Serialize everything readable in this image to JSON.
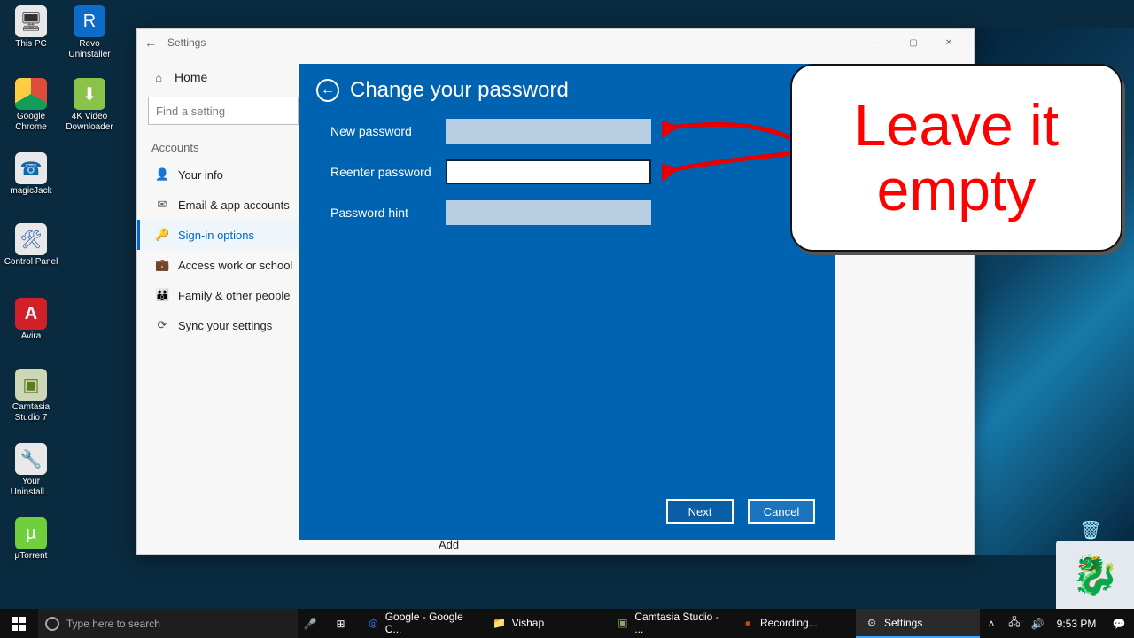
{
  "desktop": {
    "icons": [
      {
        "label": "This PC"
      },
      {
        "label": "Revo Uninstaller"
      },
      {
        "label": "Google Chrome"
      },
      {
        "label": "4K Video Downloader"
      },
      {
        "label": "magicJack"
      },
      {
        "label": "Control Panel"
      },
      {
        "label": "Avira"
      },
      {
        "label": "Camtasia Studio 7"
      },
      {
        "label": "Your Uninstall..."
      },
      {
        "label": "µTorrent"
      }
    ],
    "recycle": "Recycle Bin"
  },
  "settings": {
    "window_title": "Settings",
    "home": "Home",
    "search_placeholder": "Find a setting",
    "section": "Accounts",
    "nav": [
      {
        "icon": "👤",
        "label": "Your info"
      },
      {
        "icon": "✉",
        "label": "Email & app accounts"
      },
      {
        "icon": "🔑",
        "label": "Sign-in options"
      },
      {
        "icon": "💼",
        "label": "Access work or school"
      },
      {
        "icon": "👪",
        "label": "Family & other people"
      },
      {
        "icon": "⟳",
        "label": "Sync your settings"
      }
    ],
    "selected_nav": 2,
    "remnant": "Add"
  },
  "modal": {
    "title": "Change your password",
    "fields": {
      "new_password": "New password",
      "reenter_password": "Reenter password",
      "password_hint": "Password hint"
    },
    "values": {
      "new_password": "",
      "reenter_password": "",
      "password_hint": ""
    },
    "focused_field": "reenter_password",
    "buttons": {
      "next": "Next",
      "cancel": "Cancel"
    }
  },
  "callout": {
    "text": "Leave it empty"
  },
  "taskbar": {
    "search_placeholder": "Type here to search",
    "tasks": [
      {
        "icon": "◎",
        "label": "Google - Google C...",
        "color": "#4285f4"
      },
      {
        "icon": "📁",
        "label": "Vishap",
        "color": "#f5c967"
      },
      {
        "icon": "▣",
        "label": "Camtasia Studio - ...",
        "color": "#8aa76a"
      },
      {
        "icon": "●",
        "label": "Recording...",
        "color": "#d73a2e"
      },
      {
        "icon": "⚙",
        "label": "Settings",
        "color": "#cccccc",
        "active": true
      }
    ],
    "clock": "9:53 PM"
  }
}
